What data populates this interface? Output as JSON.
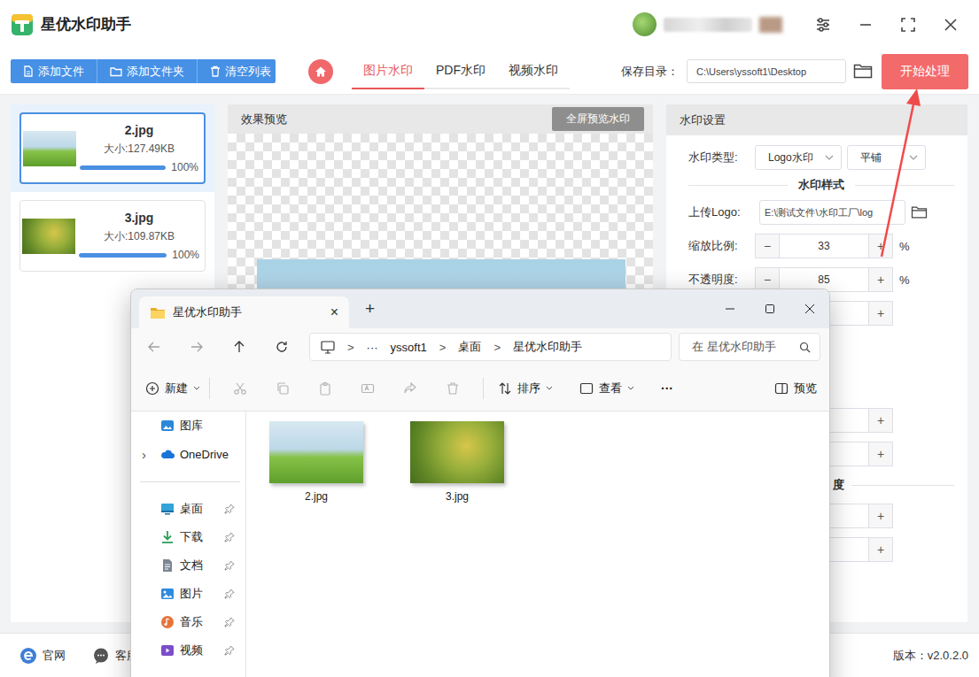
{
  "app": {
    "title": "星优水印助手"
  },
  "toolbar": {
    "buttons": [
      {
        "label": "添加文件"
      },
      {
        "label": "添加文件夹"
      },
      {
        "label": "清空列表"
      }
    ],
    "tabs": [
      {
        "label": "图片水印",
        "selected": true
      },
      {
        "label": "PDF水印",
        "selected": false
      },
      {
        "label": "视频水印",
        "selected": false
      }
    ],
    "save_label": "保存目录：",
    "save_path": "C:\\Users\\yssoft1\\Desktop",
    "start_button": "开始处理"
  },
  "files": [
    {
      "name": "2.jpg",
      "size": "大小:127.49KB",
      "percent": "100%",
      "level": 1,
      "selected": true
    },
    {
      "name": "3.jpg",
      "size": "大小:109.87KB",
      "percent": "100%",
      "level": 1,
      "selected": false
    }
  ],
  "preview": {
    "title": "效果预览",
    "button": "全屏预览水印"
  },
  "settings": {
    "title": "水印设置",
    "type_label": "水印类型:",
    "type_value": "Logo水印",
    "mode_value": "平铺",
    "style_title": "水印样式",
    "logo_label": "上传Logo:",
    "logo_path": "E:\\测试文件\\水印工厂\\log",
    "minus": "−",
    "plus": "+",
    "steppers": [
      {
        "label": "缩放比例:",
        "value": "33",
        "unit": "%"
      },
      {
        "label": "不透明度:",
        "value": "85",
        "unit": "%"
      }
    ],
    "partial_title": "度"
  },
  "bottom": {
    "links": [
      {
        "label": "官网"
      },
      {
        "label": "客服"
      }
    ],
    "version": "版本：v2.0.2.0"
  },
  "explorer": {
    "tab": "星优水印助手",
    "tab_close": "×",
    "new_tab": "+",
    "separator": ">",
    "breadcrumb_more": "···",
    "breadcrumb": [
      "yssoft1",
      "桌面",
      "星优水印助手"
    ],
    "search": "在 星优水印助手",
    "commands": {
      "new": "新建",
      "sort": "排序",
      "view": "查看",
      "more": "···",
      "preview": "预览"
    },
    "sidebar": [
      {
        "items": [
          {
            "label": "图库",
            "kind": "plain"
          },
          {
            "label": "OneDrive",
            "kind": "expandable",
            "expander": "›"
          }
        ]
      },
      {
        "items": [
          {
            "label": "桌面",
            "kind": "pinned"
          },
          {
            "label": "下载",
            "kind": "pinned"
          },
          {
            "label": "文档",
            "kind": "pinned"
          },
          {
            "label": "图片",
            "kind": "pinned"
          },
          {
            "label": "音乐",
            "kind": "pinned"
          },
          {
            "label": "视频",
            "kind": "pinned"
          }
        ]
      }
    ],
    "files": [
      {
        "name": "2.jpg"
      },
      {
        "name": "3.jpg"
      }
    ]
  }
}
